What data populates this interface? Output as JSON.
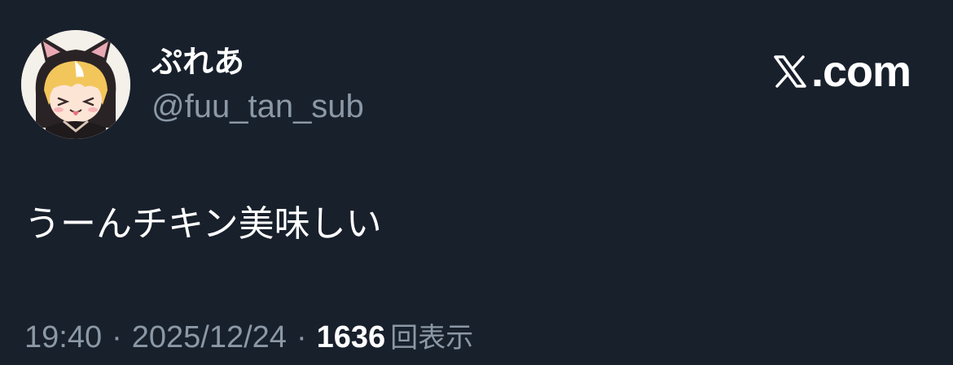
{
  "post": {
    "author": {
      "display_name": "ぷれあ",
      "handle": "@fuu_tan_sub",
      "avatar_icon": "cat-hood-girl-avatar"
    },
    "site": {
      "logo_icon": "x-logo-icon",
      "label": ".com"
    },
    "text": "うーんチキン美味しい",
    "meta": {
      "time": "19:40",
      "separator": "·",
      "date": "2025/12/24",
      "views_count": "1636",
      "views_label": "回表示"
    }
  },
  "colors": {
    "background": "#18202c",
    "text_primary": "#ffffff",
    "text_secondary": "#8b98a5"
  }
}
